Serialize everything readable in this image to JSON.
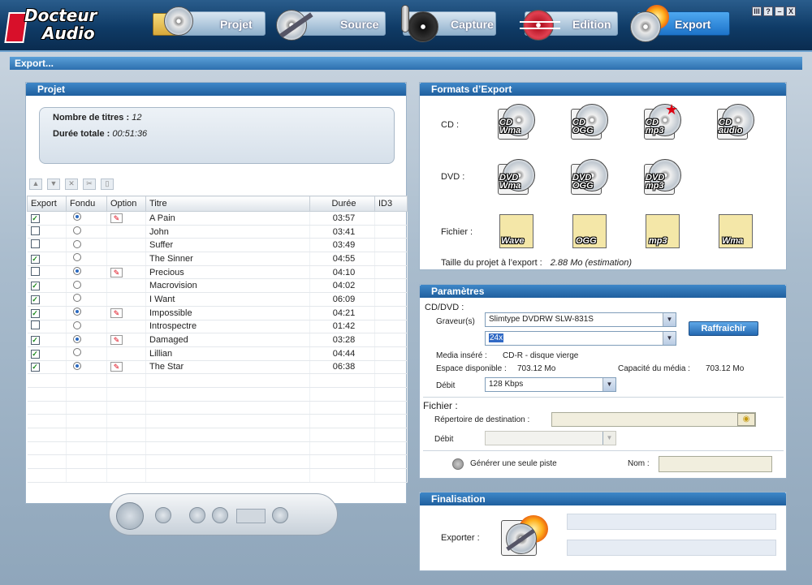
{
  "app": {
    "logo_line1": "Docteur",
    "logo_line2": "Audio",
    "window_buttons": [
      "III",
      "?",
      "–",
      "X"
    ]
  },
  "nav": {
    "tabs": [
      {
        "label": "Projet",
        "icon": "folder-disc-icon",
        "active": false
      },
      {
        "label": "Source",
        "icon": "disc-cable-icon",
        "active": false
      },
      {
        "label": "Capture",
        "icon": "microphone-disc-icon",
        "active": false
      },
      {
        "label": "Edition",
        "icon": "waveform-disc-icon",
        "active": false
      },
      {
        "label": "Export",
        "icon": "flaming-disc-icon",
        "active": true
      }
    ]
  },
  "page": {
    "title": "Export..."
  },
  "projet": {
    "title": "Projet",
    "nombre_label": "Nombre de titres :",
    "nombre_value": "12",
    "duree_label": "Durée totale :",
    "duree_value": "00:51:36",
    "toolbar": [
      "up-arrow-icon",
      "down-arrow-icon",
      "delete-icon",
      "cut-icon",
      "copy-icon"
    ],
    "columns": [
      "Export",
      "Fondu",
      "Option",
      "Titre",
      "Durée",
      "ID3"
    ],
    "tracks": [
      {
        "export": true,
        "fondu": true,
        "option": true,
        "titre": "A Pain",
        "duree": "03:57"
      },
      {
        "export": false,
        "fondu": false,
        "option": false,
        "titre": "John",
        "duree": "03:41"
      },
      {
        "export": false,
        "fondu": false,
        "option": false,
        "titre": "Suffer",
        "duree": "03:49"
      },
      {
        "export": true,
        "fondu": false,
        "option": false,
        "titre": "The Sinner",
        "duree": "04:55"
      },
      {
        "export": false,
        "fondu": true,
        "option": true,
        "titre": "Precious",
        "duree": "04:10"
      },
      {
        "export": true,
        "fondu": false,
        "option": false,
        "titre": "Macrovision",
        "duree": "04:02"
      },
      {
        "export": true,
        "fondu": false,
        "option": false,
        "titre": "I Want",
        "duree": "06:09"
      },
      {
        "export": true,
        "fondu": true,
        "option": true,
        "titre": "Impossible",
        "duree": "04:21"
      },
      {
        "export": false,
        "fondu": false,
        "option": false,
        "titre": "Introspectre",
        "duree": "01:42"
      },
      {
        "export": true,
        "fondu": true,
        "option": true,
        "titre": "Damaged",
        "duree": "03:28"
      },
      {
        "export": true,
        "fondu": false,
        "option": false,
        "titre": "Lillian",
        "duree": "04:44"
      },
      {
        "export": true,
        "fondu": true,
        "option": true,
        "titre": "The Star",
        "duree": "06:38"
      }
    ],
    "empty_rows": 8
  },
  "formats": {
    "title": "Formats d’Export",
    "cd_label": "CD :",
    "dvd_label": "DVD :",
    "fichier_label": "Fichier :",
    "cd": [
      [
        "CD",
        "Wma"
      ],
      [
        "CD",
        "OGG"
      ],
      [
        "CD",
        "mp3"
      ],
      [
        "CD",
        "audio"
      ]
    ],
    "dvd": [
      [
        "DVD",
        "Wma"
      ],
      [
        "DVD",
        "OGG"
      ],
      [
        "DVD",
        "mp3"
      ]
    ],
    "fichier": [
      "Wave",
      "OGG",
      "mp3",
      "Wma"
    ],
    "taille_label": "Taille du projet à l’export :",
    "taille_value": "2.88 Mo (estimation)"
  },
  "params": {
    "title": "Paramètres",
    "cddvd_label": "CD/DVD :",
    "graveur_label": "Graveur(s)",
    "graveur_value": "Slimtype DVDRW SLW-831S",
    "speed_value": "24x",
    "refresh_label": "Raffraichir",
    "media_label": "Media inséré :",
    "media_value": "CD-R - disque vierge",
    "espace_label": "Espace disponible :",
    "espace_value": "703.12 Mo",
    "capacite_label": "Capacité du média :",
    "capacite_value": "703.12 Mo",
    "debit_label": "Débit",
    "debit_value": "128 Kbps",
    "fichier_label": "Fichier :",
    "repertoire_label": "Répertoire de destination :",
    "debit2_label": "Débit",
    "generer_label": "Générer une seule piste",
    "nom_label": "Nom :"
  },
  "final": {
    "title": "Finalisation",
    "exporter_label": "Exporter :"
  }
}
